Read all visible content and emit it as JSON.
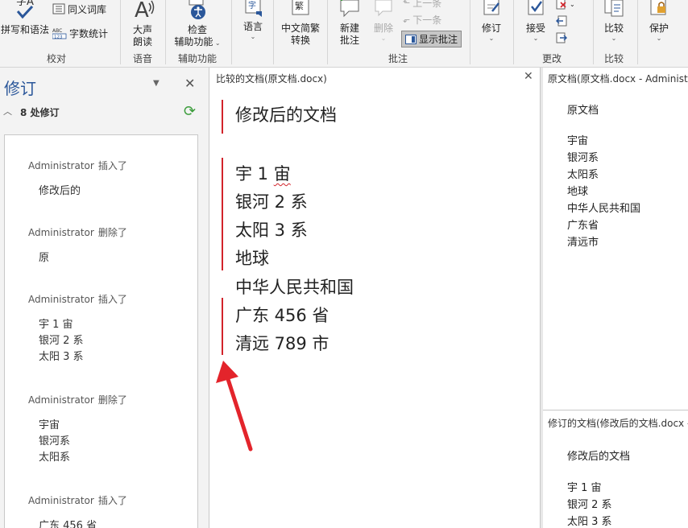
{
  "ribbon": {
    "proofing": {
      "spelling_label": "拼写和语法",
      "thesaurus_label": "同义词库",
      "wordcount_label": "字数统计",
      "group_label": "校对"
    },
    "speech": {
      "read_aloud_line1": "大声",
      "read_aloud_line2": "朗读",
      "group_label": "语音"
    },
    "accessibility": {
      "check_line1": "检查",
      "check_line2": "辅助功能",
      "group_label": "辅助功能"
    },
    "language": {
      "label": "语言"
    },
    "chinese_convert": {
      "line1": "中文简繁",
      "line2": "转换",
      "icon_char": "繁"
    },
    "comments": {
      "new_line1": "新建",
      "new_line2": "批注",
      "delete_label": "删除",
      "prev_label": "上一条",
      "next_label": "下一条",
      "show_label": "显示批注",
      "group_label": "批注"
    },
    "tracking": {
      "track_label": "修订"
    },
    "changes": {
      "accept_label": "接受",
      "group_label": "更改"
    },
    "compare": {
      "compare_label": "比较",
      "group_label": "比较"
    },
    "protect": {
      "protect_label": "保护"
    }
  },
  "revisions_pane": {
    "title": "修订",
    "count_label": "8 处修订",
    "entries": [
      {
        "author": "Administrator",
        "action": "插入了",
        "lines": [
          "修改后的"
        ]
      },
      {
        "author": "Administrator",
        "action": "删除了",
        "lines": [
          "原"
        ]
      },
      {
        "author": "Administrator",
        "action": "插入了",
        "lines": [
          "宇 1 宙",
          "银河 2 系",
          "太阳 3 系"
        ]
      },
      {
        "author": "Administrator",
        "action": "删除了",
        "lines": [
          "宇宙",
          "银河系",
          "太阳系"
        ]
      },
      {
        "author": "Administrator",
        "action": "插入了",
        "lines": [
          "广东 456 省"
        ]
      }
    ]
  },
  "compared_document": {
    "header": "比较的文档(原文档.docx)",
    "title_line": "修改后的文档",
    "line1_a": "宇 1 ",
    "line1_b": "宙",
    "lines": [
      "银河 2 系",
      "太阳 3 系",
      "地球",
      "中华人民共和国",
      "广东 456 省",
      "清远 789 市"
    ]
  },
  "original_document": {
    "header": "原文档(原文档.docx - Administrator)",
    "title": "原文档",
    "lines": [
      "宇宙",
      "银河系",
      "太阳系",
      "地球",
      "中华人民共和国",
      "广东省",
      "清远市"
    ]
  },
  "revised_document": {
    "header": "修订的文档(修改后的文档.docx - Administrator)",
    "title": "修改后的文档",
    "lines": [
      "宇 1 宙",
      "银河 2 系",
      "太阳 3 系"
    ]
  },
  "colors": {
    "accent": "#2b579a",
    "revision_bar": "#d2232a",
    "refresh_green": "#3a9c3a"
  }
}
